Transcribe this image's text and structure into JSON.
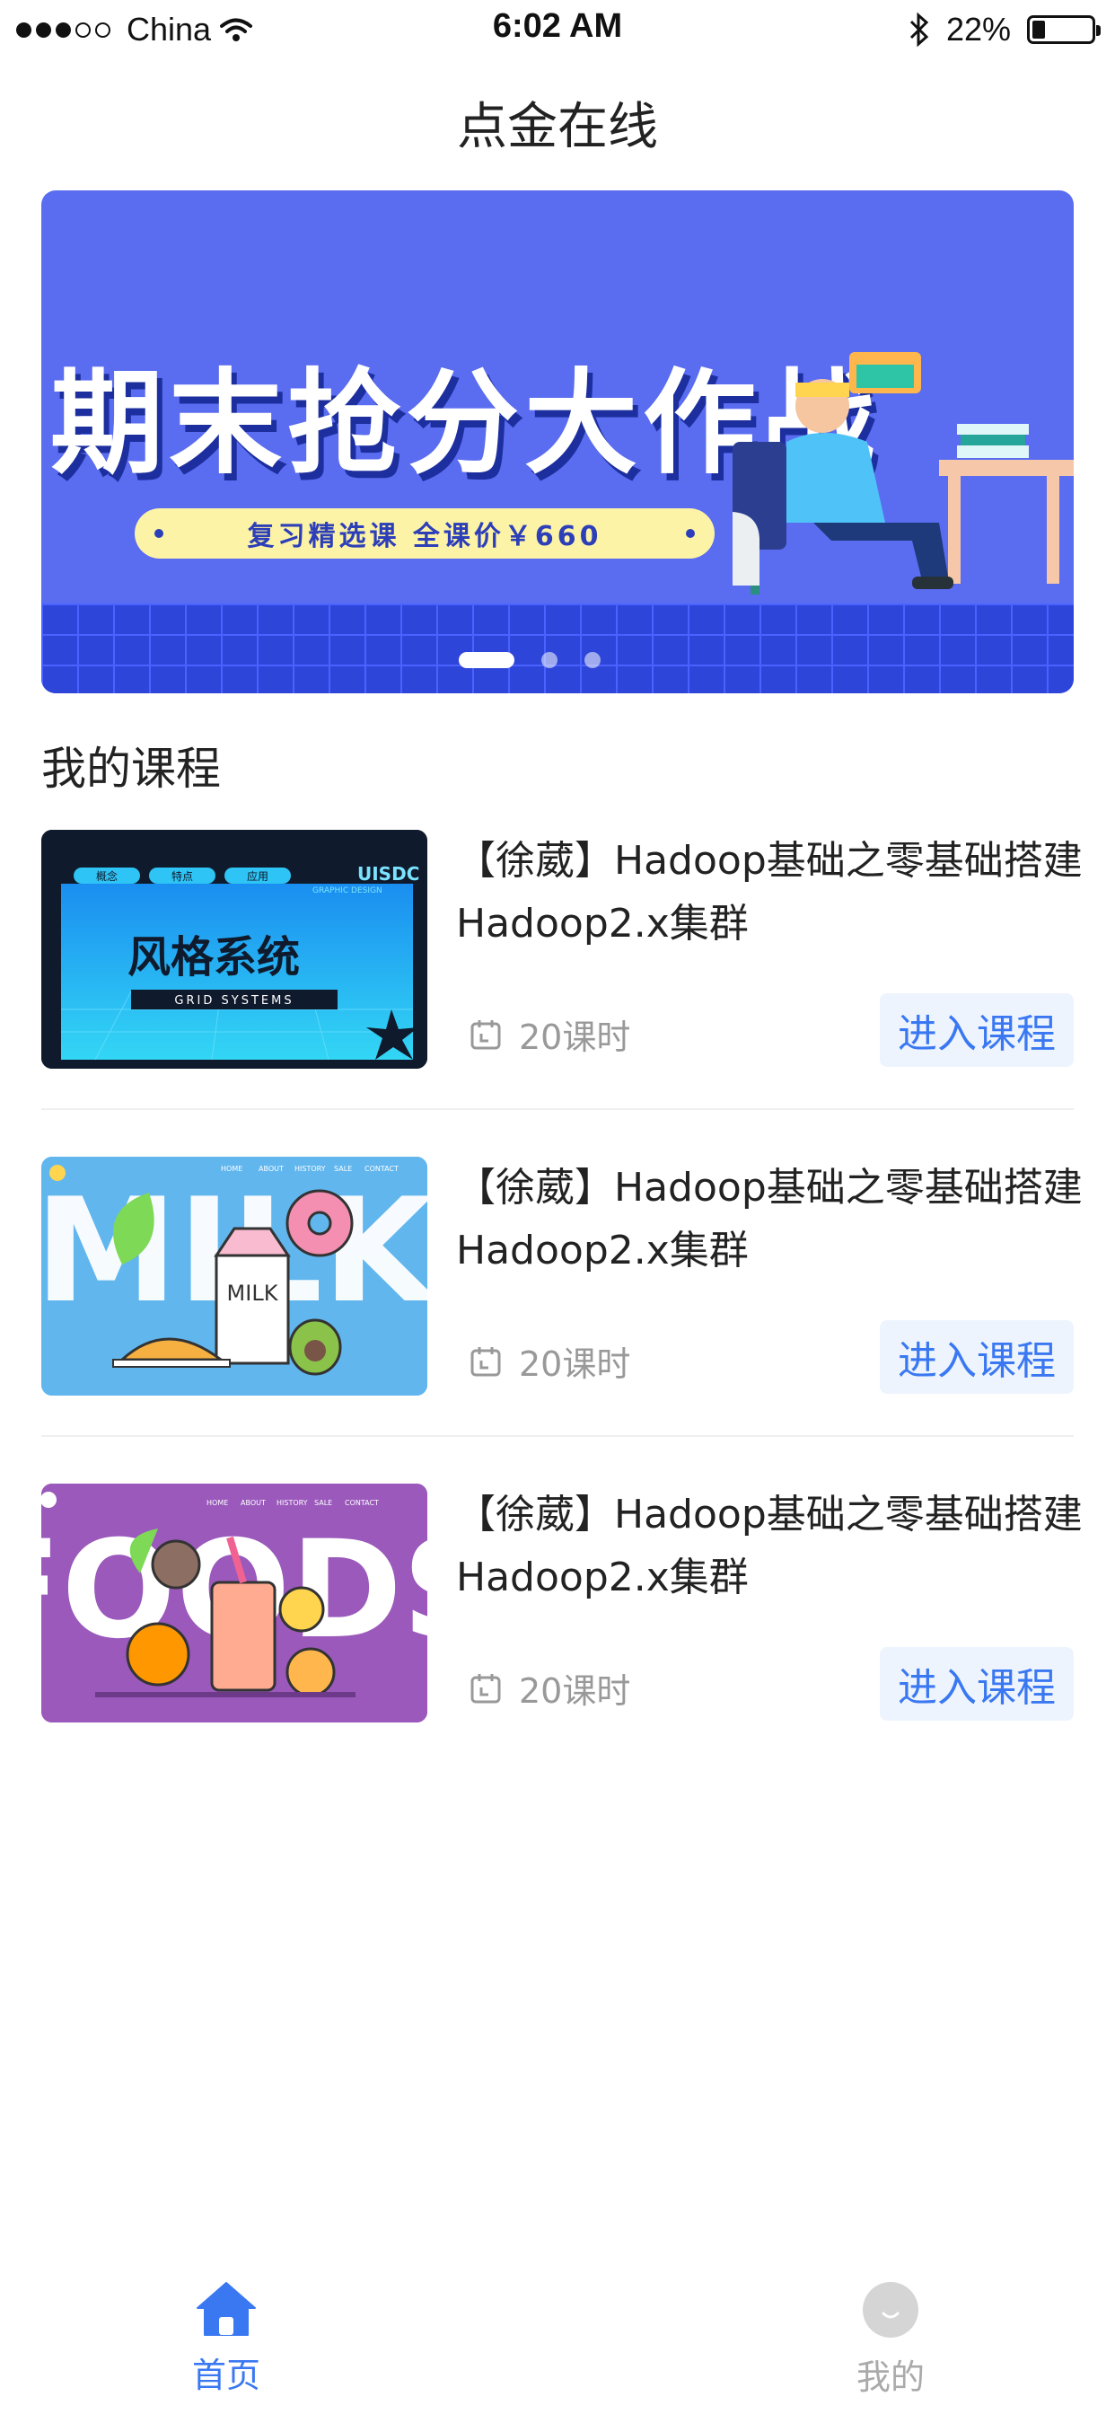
{
  "status_bar": {
    "carrier": "China",
    "time": "6:02 AM",
    "battery": "22%",
    "battery_level": 0.22
  },
  "header": {
    "title": "点金在线"
  },
  "banner": {
    "headline": "期末抢分大作战",
    "subtitle": "复习精选课 全课价￥660",
    "slide_count": 3,
    "active_slide": 1
  },
  "section": {
    "title": "我的课程"
  },
  "courses": [
    {
      "title": "【徐葳】Hadoop基础之零基础搭建Hadoop2.x集群",
      "lessons": "20课时",
      "action": "进入课程",
      "thumb_texts": [
        "概念",
        "特点",
        "应用",
        "UISDC",
        "GRAPHIC DESIGN",
        "风格系统",
        "GRID SYSTEMS"
      ]
    },
    {
      "title": "【徐葳】Hadoop基础之零基础搭建Hadoop2.x集群",
      "lessons": "20课时",
      "action": "进入课程",
      "thumb_texts": [
        "HOME",
        "ABOUT",
        "HISTORY",
        "SALE",
        "CONTACT",
        "MILK"
      ]
    },
    {
      "title": "【徐葳】Hadoop基础之零基础搭建Hadoop2.x集群",
      "lessons": "20课时",
      "action": "进入课程",
      "thumb_texts": [
        "HOME",
        "ABOUT",
        "HISTORY",
        "SALE",
        "CONTACT",
        "FOODS"
      ]
    }
  ],
  "tab_bar": {
    "tabs": [
      {
        "label": "首页",
        "icon": "home-icon",
        "active": true
      },
      {
        "label": "我的",
        "icon": "profile-icon",
        "active": false
      }
    ]
  },
  "colors": {
    "accent": "#3A78F2",
    "banner_bg": "#5A6CF0",
    "button_bg": "#EEF4FE"
  }
}
